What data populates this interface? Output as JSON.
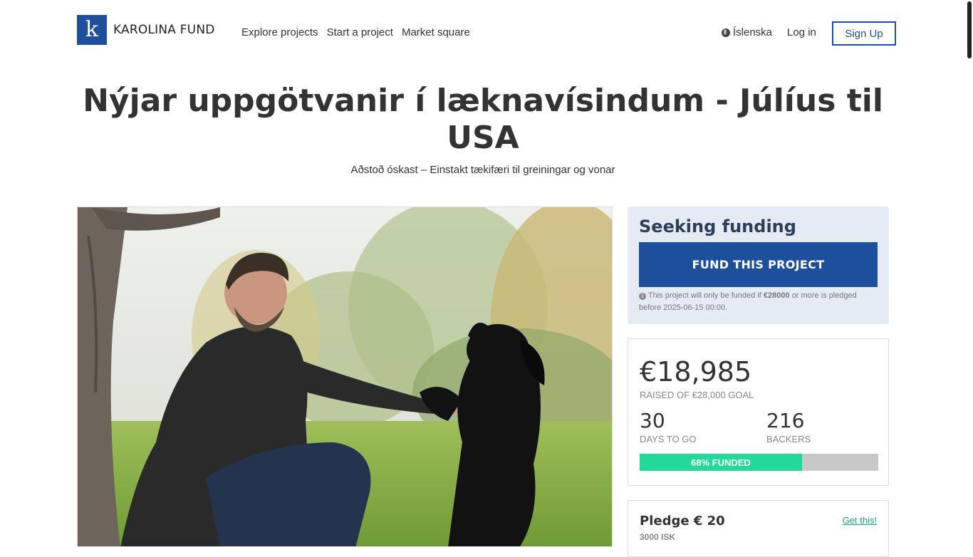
{
  "header": {
    "logo_letter": "k",
    "logo_text": "KAROLINA FUND",
    "nav": [
      "Explore projects",
      "Start a project",
      "Market square"
    ],
    "language": "Íslenska",
    "login": "Log in",
    "signup": "Sign Up"
  },
  "project": {
    "title": "Nýjar uppgötvanir í læknavísindum - Júlíus til USA",
    "subtitle": "Aðstoð óskast – Einstakt tækifæri til greiningar og vonar"
  },
  "funding": {
    "heading": "Seeking funding",
    "button": "FUND THIS PROJECT",
    "note_prefix": "This project will only be funded if",
    "note_amount": "€28000",
    "note_suffix": "or more is pledged before 2025-06-15 00:00."
  },
  "stats": {
    "raised": "€18,985",
    "raised_label": "RAISED OF €28,000 GOAL",
    "days": "30",
    "days_label": "DAYS TO GO",
    "backers": "216",
    "backers_label": "BACKERS",
    "funded_label": "68% FUNDED",
    "funded_fraction": 0.68
  },
  "pledge": {
    "title": "Pledge € 20",
    "sub": "3000 ISK",
    "link": "Get this!"
  },
  "colors": {
    "brand_blue": "#1d4f9d",
    "progress_green": "#22d99a",
    "panel_bg": "#e5ebf4"
  }
}
